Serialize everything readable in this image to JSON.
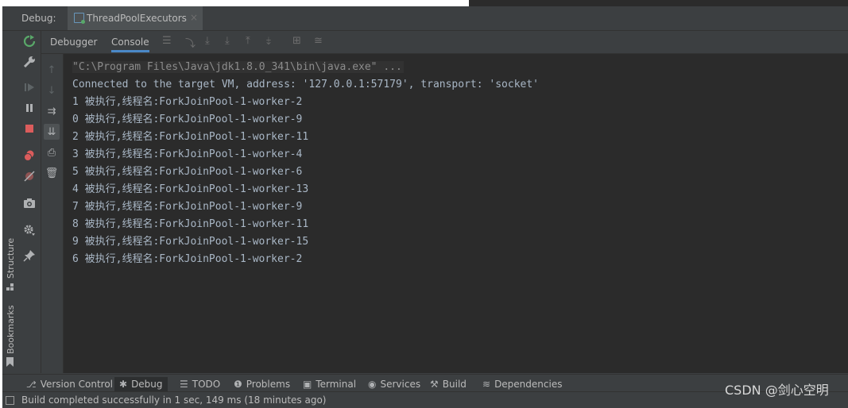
{
  "window": {
    "debug_label": "Debug:",
    "tab_title": "ThreadPoolExecutors",
    "tab_close": "×"
  },
  "side_panels": {
    "structure": "Structure",
    "bookmarks": "Bookmarks"
  },
  "subtabs": {
    "debugger": "Debugger",
    "console": "Console"
  },
  "console": {
    "command": "\"C:\\Program Files\\Java\\jdk1.8.0_341\\bin\\java.exe\" ...",
    "lines": [
      "Connected to the target VM, address: '127.0.0.1:57179', transport: 'socket'",
      "1 被执行,线程名:ForkJoinPool-1-worker-2",
      "0 被执行,线程名:ForkJoinPool-1-worker-9",
      "2 被执行,线程名:ForkJoinPool-1-worker-11",
      "3 被执行,线程名:ForkJoinPool-1-worker-4",
      "5 被执行,线程名:ForkJoinPool-1-worker-6",
      "4 被执行,线程名:ForkJoinPool-1-worker-13",
      "7 被执行,线程名:ForkJoinPool-1-worker-9",
      "8 被执行,线程名:ForkJoinPool-1-worker-11",
      "9 被执行,线程名:ForkJoinPool-1-worker-15",
      "6 被执行,线程名:ForkJoinPool-1-worker-2"
    ]
  },
  "bottom_tabs": {
    "version_control": "Version Control",
    "debug": "Debug",
    "todo": "TODO",
    "problems": "Problems",
    "terminal": "Terminal",
    "services": "Services",
    "build": "Build",
    "dependencies": "Dependencies"
  },
  "status": {
    "message": "Build completed successfully in 1 sec, 149 ms (18 minutes ago)"
  },
  "watermark": "CSDN @剑心空明",
  "colors": {
    "background": "#3c3f41",
    "console_bg": "#2b2b2b",
    "console_text": "#a9b7c6",
    "accent": "#4a88c7",
    "resume_green": "#59a869",
    "stop_red": "#db5c5c"
  }
}
